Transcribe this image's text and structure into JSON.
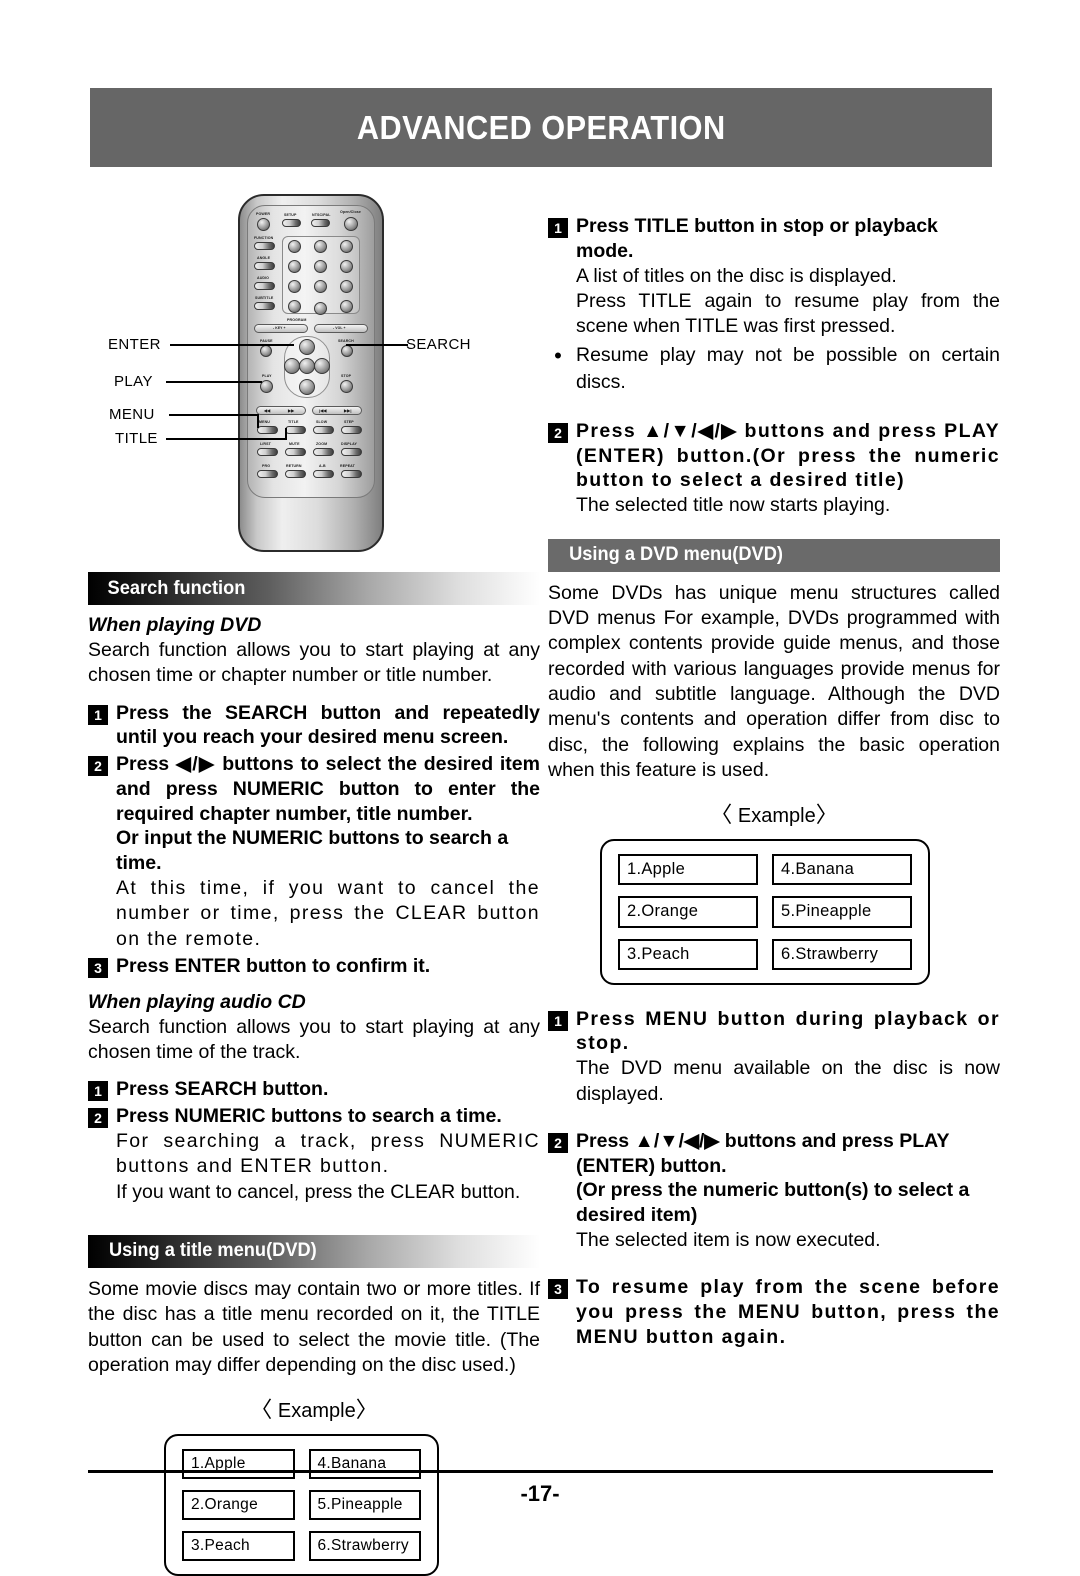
{
  "page": {
    "title": "ADVANCED OPERATION",
    "page_number": "-17-"
  },
  "remote_figure": {
    "callouts": [
      {
        "name": "enter",
        "label": "ENTER"
      },
      {
        "name": "play",
        "label": "PLAY"
      },
      {
        "name": "menu",
        "label": "MENU"
      },
      {
        "name": "title",
        "label": "TITLE"
      },
      {
        "name": "search",
        "label": "SEARCH"
      }
    ],
    "buttons": [
      "POWER",
      "SETUP",
      "NTSC/PAL",
      "Open/Close",
      "FUNCTION",
      "ANGLE",
      "AUDIO",
      "SUBTITLE",
      "PROGRAM",
      "KEY",
      "VOL",
      "PAUSE",
      "SEARCH",
      "PLAY",
      "STOP",
      "MENU",
      "TITLE",
      "SLOW",
      "STEP",
      "L/RST",
      "MUTE",
      "ZOOM",
      "DISPLAY",
      "PRG",
      "RETURN",
      "A-B",
      "REPEAT"
    ],
    "program_label": "PROGRAM",
    "key_label": "KEY",
    "vol_label": "VOL"
  },
  "left_column": {
    "search_section": {
      "header": "Search function",
      "dvd_subhead": "When playing DVD",
      "dvd_intro": "Search function allows you to start playing at any chosen time or chapter number or title number.",
      "steps": [
        {
          "num": "1",
          "bold": "Press the SEARCH button and repeatedly until you reach your desired menu screen.",
          "normal": ""
        },
        {
          "num": "2",
          "bold": "Press ◀/▶ buttons to select the desired item and press NUMERIC button to enter the required chapter number, title number.",
          "bold2": "Or input the NUMERIC buttons to search a time.",
          "normal": "At this time, if you want to cancel the number or time, press the CLEAR button on the remote."
        },
        {
          "num": "3",
          "bold": "Press ENTER button to confirm it.",
          "normal": ""
        }
      ],
      "cd_subhead": "When playing audio CD",
      "cd_intro": "Search function allows you to start playing at any chosen time of the track.",
      "cd_steps": [
        {
          "num": "1",
          "bold": "Press SEARCH button.",
          "normal": ""
        },
        {
          "num": "2",
          "bold": "Press NUMERIC buttons to search a time.",
          "normal": "For searching a track, press NUMERIC buttons and ENTER button.",
          "normal2": "If you want to cancel, press the CLEAR button."
        }
      ]
    },
    "title_menu_section": {
      "header": "Using a title menu(DVD)",
      "body": "Some movie discs may contain two or more titles. If the disc has a title menu recorded on it, the TITLE button can be used to select the movie title. (The operation may differ depending on the disc used.)",
      "example_label": "Example",
      "menu_items": [
        "1.Apple",
        "4.Banana",
        "2.Orange",
        "5.Pineapple",
        "3.Peach",
        "6.Strawberry"
      ]
    }
  },
  "right_column": {
    "title_steps": [
      {
        "num": "1",
        "bold": "Press TITLE button in stop or playback mode.",
        "normal": "A list of titles on the disc is displayed.",
        "normal2": "Press TITLE again to resume play from the scene when TITLE was first pressed."
      }
    ],
    "bullet": "Resume play may not be possible on certain discs.",
    "title_step2": {
      "num": "2",
      "bold": "Press ▲/▼/◀/▶ buttons and press PLAY (ENTER) button.(Or press the numeric button to select a desired title)",
      "normal": "The selected title now starts playing."
    },
    "dvd_menu_section": {
      "header": "Using a DVD menu(DVD)",
      "body": "Some DVDs has unique menu structures called DVD menus For example, DVDs programmed with complex contents provide guide menus, and those recorded with various languages provide menus for audio and subtitle language. Although the DVD menu's contents and operation differ from disc to disc, the following explains the basic operation when this feature is used.",
      "example_label": "Example",
      "menu_items": [
        "1.Apple",
        "4.Banana",
        "2.Orange",
        "5.Pineapple",
        "3.Peach",
        "6.Strawberry"
      ],
      "steps": [
        {
          "num": "1",
          "bold": "Press MENU button during playback or stop.",
          "normal": "The DVD menu available on the disc is now displayed."
        },
        {
          "num": "2",
          "bold": "Press ▲/▼/◀/▶ buttons and press PLAY (ENTER) button.",
          "bold2": "(Or press the numeric button(s) to select a desired item)",
          "normal": "The selected item is now executed."
        },
        {
          "num": "3",
          "bold": "To resume play from the scene before you press the MENU button, press the MENU button again.",
          "normal": ""
        }
      ]
    }
  }
}
